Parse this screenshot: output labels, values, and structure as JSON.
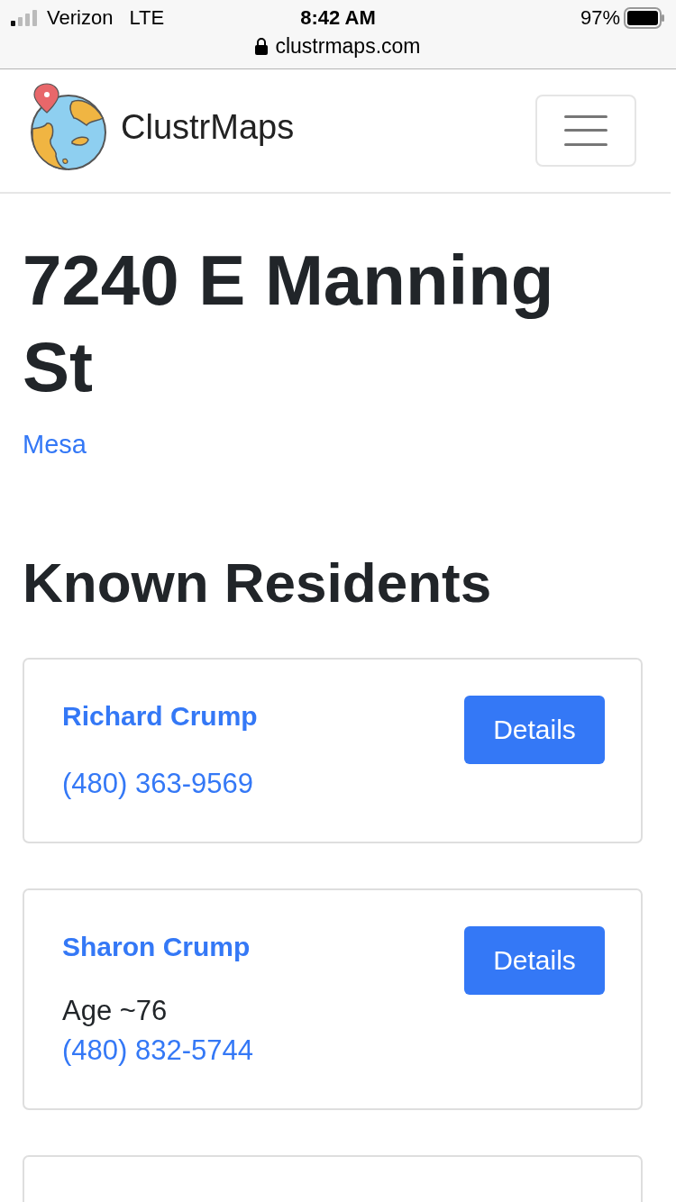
{
  "status_bar": {
    "carrier": "Verizon",
    "network": "LTE",
    "time": "8:42 AM",
    "battery": "97%",
    "url": "clustrmaps.com"
  },
  "navbar": {
    "brand": "ClustrMaps"
  },
  "address": {
    "title": "7240 E Manning St",
    "city": "Mesa"
  },
  "residents": {
    "heading": "Known Residents",
    "items": [
      {
        "name": "Richard Crump",
        "phone": "(480) 363-9569",
        "button": "Details"
      },
      {
        "name": "Sharon Crump",
        "age": "Age ~76",
        "phone": "(480) 832-5744",
        "button": "Details"
      }
    ]
  }
}
